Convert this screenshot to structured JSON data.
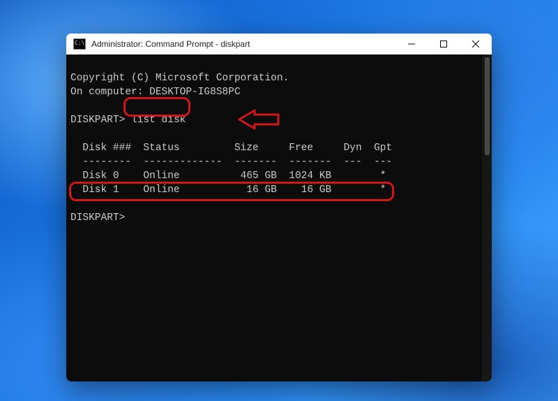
{
  "window": {
    "title": "Administrator: Command Prompt - diskpart"
  },
  "terminal": {
    "copyright": "Copyright (C) Microsoft Corporation.",
    "on_computer": "On computer: DESKTOP-IG8S8PC",
    "prompt1": "DISKPART>",
    "command": "list disk",
    "header": "  Disk ###  Status         Size     Free     Dyn  Gpt",
    "divider": "  --------  -------------  -------  -------  ---  ---",
    "row0": "  Disk 0    Online          465 GB  1024 KB        *",
    "row1": "  Disk 1    Online           16 GB    16 GB        *",
    "prompt2": "DISKPART>"
  },
  "chart_data": {
    "type": "table",
    "title": "diskpart list disk",
    "columns": [
      "Disk ###",
      "Status",
      "Size",
      "Free",
      "Dyn",
      "Gpt"
    ],
    "rows": [
      {
        "Disk ###": "Disk 0",
        "Status": "Online",
        "Size": "465 GB",
        "Free": "1024 KB",
        "Dyn": "",
        "Gpt": "*"
      },
      {
        "Disk ###": "Disk 1",
        "Status": "Online",
        "Size": "16 GB",
        "Free": "16 GB",
        "Dyn": "",
        "Gpt": "*"
      }
    ]
  }
}
